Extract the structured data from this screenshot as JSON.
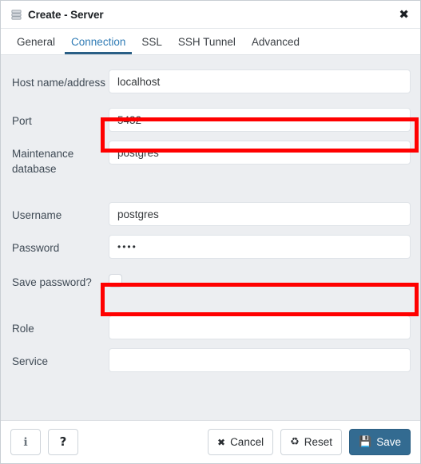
{
  "window": {
    "title": "Create - Server",
    "icon": "server-stack-icon",
    "close_label": "✖"
  },
  "tabs": [
    {
      "label": "General",
      "active": false
    },
    {
      "label": "Connection",
      "active": true
    },
    {
      "label": "SSL",
      "active": false
    },
    {
      "label": "SSH Tunnel",
      "active": false
    },
    {
      "label": "Advanced",
      "active": false
    }
  ],
  "form": {
    "host": {
      "label": "Host name/address",
      "value": "localhost",
      "highlighted": true
    },
    "port": {
      "label": "Port",
      "value": "5432"
    },
    "maintdb": {
      "label": "Maintenance database",
      "value": "postgres"
    },
    "username": {
      "label": "Username",
      "value": "postgres"
    },
    "password": {
      "label": "Password",
      "value": "••••",
      "highlighted": true
    },
    "savepwd": {
      "label": "Save password?",
      "checked": false
    },
    "role": {
      "label": "Role",
      "value": ""
    },
    "service": {
      "label": "Service",
      "value": ""
    }
  },
  "footer": {
    "info": {
      "label": "",
      "icon": "ℹ",
      "name": "info-icon"
    },
    "help": {
      "label": "",
      "icon": "?",
      "name": "question-mark-icon"
    },
    "cancel": {
      "label": "Cancel",
      "icon": "✖"
    },
    "reset": {
      "label": "Reset",
      "icon": "♻"
    },
    "save": {
      "label": "Save",
      "icon": "💾"
    }
  },
  "colors": {
    "accent": "#336b91",
    "tab_active": "#2f7bb5",
    "highlight": "#ff0000",
    "form_bg": "#eceef1"
  }
}
